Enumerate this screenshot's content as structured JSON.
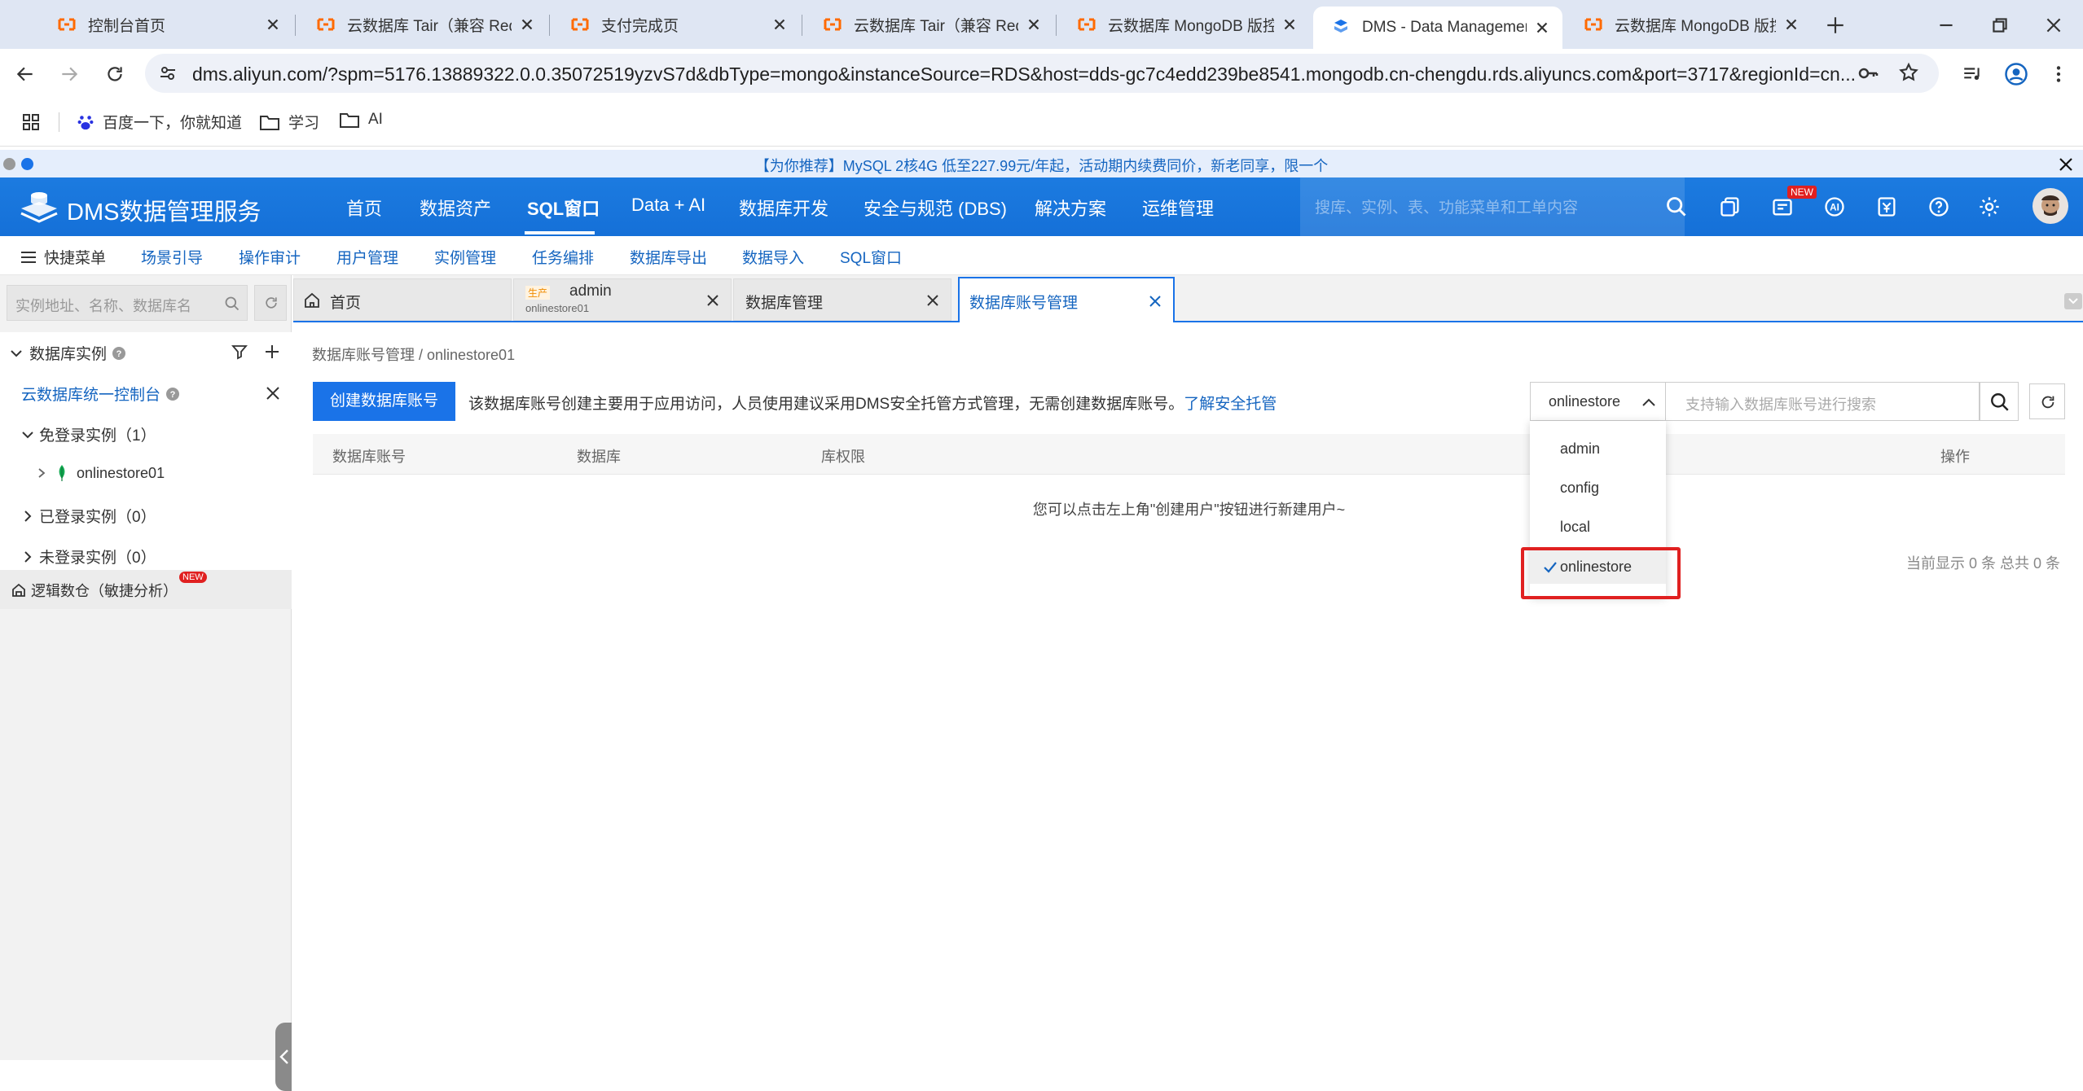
{
  "browser": {
    "tabs": [
      {
        "title": "控制台首页"
      },
      {
        "title": "云数据库 Tair（兼容 Redis"
      },
      {
        "title": "支付完成页"
      },
      {
        "title": "云数据库 Tair（兼容 Redis"
      },
      {
        "title": "云数据库 MongoDB 版控"
      },
      {
        "title": "DMS - Data Management"
      },
      {
        "title": "云数据库 MongoDB 版控"
      }
    ],
    "url": "dms.aliyun.com/?spm=5176.13889322.0.0.35072519yzvS7d&dbType=mongo&instanceSource=RDS&host=dds-gc7c4edd239be8541.mongodb.cn-chengdu.rds.aliyuncs.com&port=3717&regionId=cn...",
    "bookmarks": [
      "百度一下，你就知道",
      "学习",
      "AI"
    ]
  },
  "announcement": "【为你推荐】MySQL 2核4G 低至227.99元/年起，活动期内续费同价，新老同享，限一个",
  "header": {
    "logo_text": "DMS数据管理服务",
    "nav": [
      "首页",
      "数据资产",
      "SQL窗口",
      "Data + AI",
      "数据库开发",
      "安全与规范 (DBS)",
      "解决方案",
      "运维管理"
    ],
    "search_placeholder": "搜库、实例、表、功能菜单和工单内容",
    "new_badge": "NEW"
  },
  "quick_menu": {
    "label": "快捷菜单",
    "items": [
      "场景引导",
      "操作审计",
      "用户管理",
      "实例管理",
      "任务编排",
      "数据库导出",
      "数据导入",
      "SQL窗口"
    ]
  },
  "sidebar": {
    "search_placeholder": "实例地址、名称、数据库名",
    "section_title": "数据库实例",
    "console_link": "云数据库统一控制台",
    "groups": [
      {
        "label": "免登录实例（1）"
      },
      {
        "label": "已登录实例（0）"
      },
      {
        "label": "未登录实例（0）"
      }
    ],
    "instance": "onlinestore01",
    "logic_db": "逻辑数仓（敏捷分析）",
    "logic_badge": "NEW"
  },
  "work_tabs": [
    {
      "label": "首页"
    },
    {
      "label": "admin",
      "sub": "onlinestore01",
      "env": "生产"
    },
    {
      "label": "数据库管理"
    },
    {
      "label": "数据库账号管理"
    }
  ],
  "content": {
    "breadcrumb": "数据库账号管理 / onlinestore01",
    "create_button": "创建数据库账号",
    "notice": "该数据库账号创建主要用于应用访问，人员使用建议采用DMS安全托管方式管理，无需创建数据库账号。",
    "notice_link": "了解安全托管",
    "db_select_value": "onlinestore",
    "search_placeholder": "支持输入数据库账号进行搜索",
    "columns": [
      "数据库账号",
      "数据库",
      "库权限",
      "操作"
    ],
    "empty_message": "您可以点击左上角\"创建用户\"按钮进行新建用户~",
    "count_text": "当前显示 0 条 总共 0 条",
    "dropdown_options": [
      "admin",
      "config",
      "local",
      "onlinestore"
    ],
    "dropdown_selected": "onlinestore"
  },
  "colors": {
    "brand_blue": "#1a73e8",
    "highlight_red": "#e02020",
    "env_orange": "#f08c00"
  }
}
